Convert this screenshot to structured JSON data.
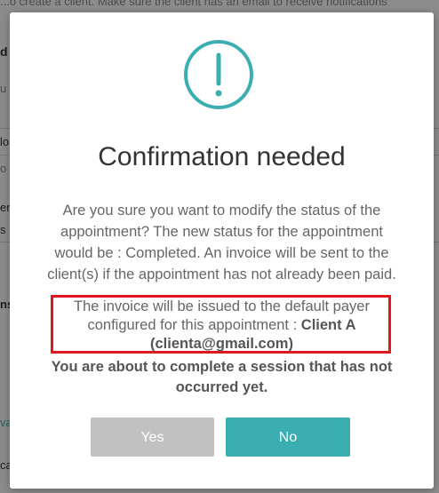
{
  "background": {
    "notice": "...o create a client. Make sure the client has an email to receive notifications",
    "fragments": [
      "d",
      "u",
      "lo",
      "o c",
      "en",
      "s",
      "ns",
      "va",
      "ca"
    ]
  },
  "modal": {
    "icon": "exclamation-circle-icon",
    "title": "Confirmation needed",
    "message": "Are you sure you want to modify the status of the appointment? The new status for the appointment would be : Completed. An invoice will be sent to the client(s) if the appointment has not already been paid.",
    "invoice_prefix": "The invoice will be issued to the default payer configured for this appointment :",
    "invoice_payer": "Client A (clienta@gmail.com)",
    "warning": "You are about to complete a session that has not occurred yet.",
    "yes_label": "Yes",
    "no_label": "No"
  },
  "colors": {
    "accent": "#3aaeb1",
    "highlight_border": "#e0191f",
    "yes_button": "#c1c1c1"
  }
}
